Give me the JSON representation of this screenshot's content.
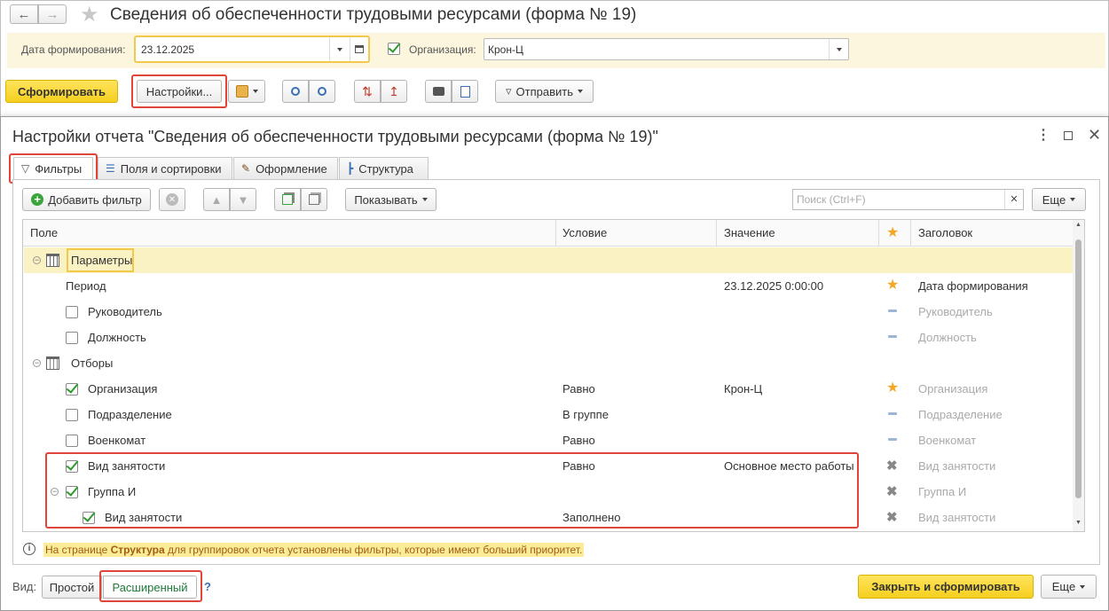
{
  "window": {
    "title": "Сведения об обеспеченности трудовыми ресурсами (форма № 19)"
  },
  "params": {
    "date_label": "Дата формирования:",
    "date_value": "23.12.2025",
    "org_label": "Организация:",
    "org_value": "Крон-Ц"
  },
  "toolbar": {
    "generate": "Сформировать",
    "settings": "Настройки...",
    "send": "Отправить"
  },
  "dialog": {
    "title": "Настройки отчета \"Сведения об обеспеченности трудовыми ресурсами (форма № 19)\"",
    "tabs": [
      "Фильтры",
      "Поля и сортировки",
      "Оформление",
      "Структура"
    ],
    "add_filter": "Добавить фильтр",
    "show": "Показывать",
    "search_placeholder": "Поиск (Ctrl+F)",
    "more": "Еще",
    "columns": {
      "field": "Поле",
      "condition": "Условие",
      "value": "Значение",
      "header": "Заголовок"
    },
    "rows": [
      {
        "field": "Параметры",
        "condition": "",
        "value": "",
        "header": "",
        "mark": "none"
      },
      {
        "field": "Период",
        "condition": "",
        "value": "23.12.2025 0:00:00",
        "header": "Дата формирования",
        "mark": "star"
      },
      {
        "field": "Руководитель",
        "condition": "",
        "value": "",
        "header": "Руководитель",
        "mark": "dash"
      },
      {
        "field": "Должность",
        "condition": "",
        "value": "",
        "header": "Должность",
        "mark": "dash"
      },
      {
        "field": "Отборы",
        "condition": "",
        "value": "",
        "header": "",
        "mark": "none"
      },
      {
        "field": "Организация",
        "condition": "Равно",
        "value": "Крон-Ц",
        "header": "Организация",
        "mark": "star"
      },
      {
        "field": "Подразделение",
        "condition": "В группе",
        "value": "",
        "header": "Подразделение",
        "mark": "dash"
      },
      {
        "field": "Военкомат",
        "condition": "Равно",
        "value": "",
        "header": "Военкомат",
        "mark": "dash"
      },
      {
        "field": "Вид занятости",
        "condition": "Равно",
        "value": "Основное место работы",
        "header": "Вид занятости",
        "mark": "x"
      },
      {
        "field": "Группа И",
        "condition": "",
        "value": "",
        "header": "Группа И",
        "mark": "x"
      },
      {
        "field": "Вид занятости",
        "condition": "Заполнено",
        "value": "",
        "header": "Вид занятости",
        "mark": "x"
      }
    ],
    "info_prefix": "На странице ",
    "info_bold": "Структура",
    "info_suffix": " для группировок отчета установлены фильтры, которые имеют больший приоритет.",
    "view_label": "Вид:",
    "view_simple": "Простой",
    "view_extended": "Расширенный",
    "help": "?",
    "close_generate": "Закрыть и сформировать",
    "more_bottom": "Еще"
  }
}
